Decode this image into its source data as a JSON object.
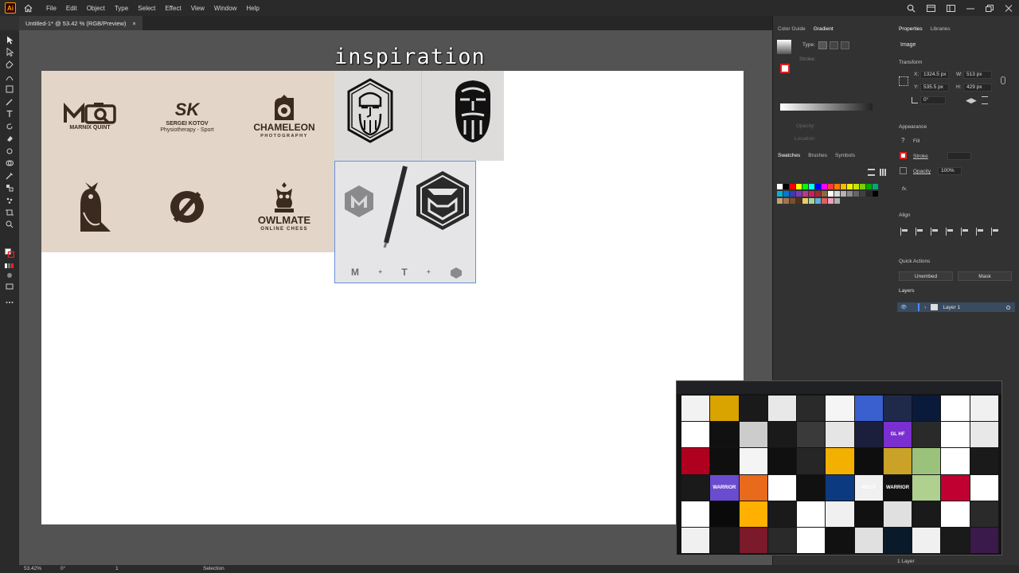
{
  "menu": [
    "File",
    "Edit",
    "Object",
    "Type",
    "Select",
    "Effect",
    "View",
    "Window",
    "Help"
  ],
  "document_tab": {
    "label": "Untitled-1* @ 53.42 % (RGB/Preview)",
    "close": "×"
  },
  "canvas": {
    "title": "inspiration"
  },
  "logos": [
    {
      "mark": "MQ",
      "sub": "MARNIX QUINT"
    },
    {
      "mark": "SK",
      "sub": "SERGEI KOTOV",
      "sub2": "Physiotherapy - Sport"
    },
    {
      "mark": "CHAMELEON",
      "sub": "PHOTOGRAPHY"
    },
    {
      "mark": "",
      "sub": ""
    },
    {
      "mark": "Ø",
      "sub": ""
    },
    {
      "mark": "OWLMATE",
      "sub": "ONLINE CHESS"
    }
  ],
  "mt_block": {
    "letters": [
      "M",
      "+",
      "T",
      "+"
    ]
  },
  "panels": {
    "color_tabs": [
      "Color Guide",
      "Gradient"
    ],
    "gradient": {
      "type_label": "Type:",
      "stroke_label": "Stroke:",
      "opacity_label": "Opacity:",
      "location_label": "Location:"
    },
    "swatch_tabs": [
      "Swatches",
      "Brushes",
      "Symbols"
    ],
    "props_tabs": [
      "Properties",
      "Libraries"
    ],
    "props": {
      "object_type": "Image",
      "transform_label": "Transform",
      "x_label": "X:",
      "x_value": "1324.5 px",
      "y_label": "Y:",
      "y_value": "535.5 px",
      "w_label": "W:",
      "w_value": "513 px",
      "h_label": "H:",
      "h_value": "429 px",
      "angle_value": "0°",
      "appearance_label": "Appearance",
      "fill_label": "Fill",
      "stroke_label": "Stroke",
      "opacity_label": "Opacity",
      "opacity_value": "100%",
      "fx_label": "fx.",
      "align_label": "Align",
      "quick_actions_label": "Quick Actions",
      "unembed_label": "Unembed",
      "mask_label": "Mask"
    },
    "layers": {
      "title": "Layers",
      "layer_name": "Layer 1",
      "count": "1 Layer"
    }
  },
  "status": {
    "zoom": "53.42%",
    "rotation": "0°",
    "artboard": "1",
    "tool": "Selection"
  },
  "thumb": {
    "texts": [
      "GL HF",
      "WARRIOR",
      "WARRIOR",
      "WOLF"
    ]
  }
}
